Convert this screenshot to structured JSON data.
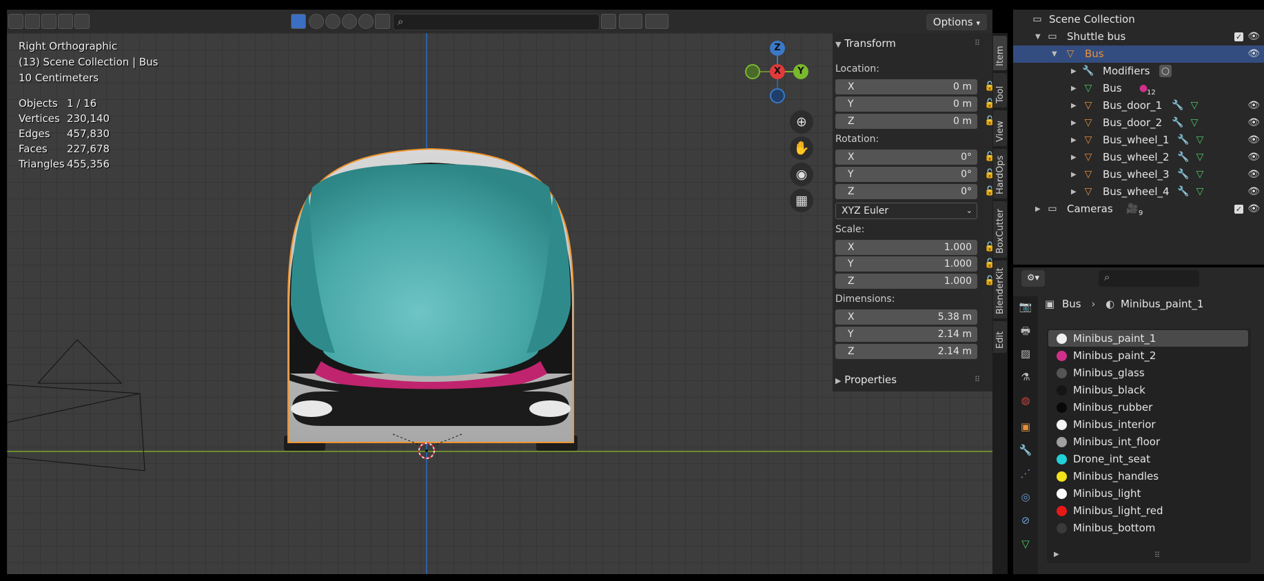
{
  "viewport": {
    "view_name": "Right Orthographic",
    "collection_info": "(13) Scene Collection | Bus",
    "grid_scale": "10 Centimeters",
    "stats": [
      {
        "label": "Objects",
        "value": "1 / 16"
      },
      {
        "label": "Vertices",
        "value": "230,140"
      },
      {
        "label": "Edges",
        "value": "457,830"
      },
      {
        "label": "Faces",
        "value": "227,678"
      },
      {
        "label": "Triangles",
        "value": "455,356"
      }
    ],
    "options_label": "Options",
    "gizmo": {
      "z": "Z",
      "x": "X",
      "y": "Y"
    }
  },
  "npanel": {
    "transform_title": "Transform",
    "location_label": "Location:",
    "location": [
      {
        "axis": "X",
        "value": "0 m"
      },
      {
        "axis": "Y",
        "value": "0 m"
      },
      {
        "axis": "Z",
        "value": "0 m"
      }
    ],
    "rotation_label": "Rotation:",
    "rotation": [
      {
        "axis": "X",
        "value": "0°"
      },
      {
        "axis": "Y",
        "value": "0°"
      },
      {
        "axis": "Z",
        "value": "0°"
      }
    ],
    "rotation_mode": "XYZ Euler",
    "scale_label": "Scale:",
    "scale": [
      {
        "axis": "X",
        "value": "1.000"
      },
      {
        "axis": "Y",
        "value": "1.000"
      },
      {
        "axis": "Z",
        "value": "1.000"
      }
    ],
    "dimensions_label": "Dimensions:",
    "dimensions": [
      {
        "axis": "X",
        "value": "5.38 m"
      },
      {
        "axis": "Y",
        "value": "2.14 m"
      },
      {
        "axis": "Z",
        "value": "2.14 m"
      }
    ],
    "properties_title": "Properties",
    "tabs": [
      "Item",
      "Tool",
      "View",
      "HardOps",
      "BoxCutter",
      "BlenderKit",
      "Edit"
    ]
  },
  "outliner": {
    "rows": [
      {
        "name": "Scene Collection",
        "icon": "collection-icon"
      },
      {
        "name": "Shuttle bus",
        "icon": "collection-icon"
      },
      {
        "name": "Bus",
        "icon": "mesh-object-icon"
      },
      {
        "name": "Modifiers",
        "icon": "wrench-icon"
      },
      {
        "name": "Bus",
        "icon": "mesh-data-icon",
        "badge": "12"
      },
      {
        "name": "Bus_door_1",
        "icon": "mesh-object-icon"
      },
      {
        "name": "Bus_door_2",
        "icon": "mesh-object-icon"
      },
      {
        "name": "Bus_wheel_1",
        "icon": "mesh-object-icon"
      },
      {
        "name": "Bus_wheel_2",
        "icon": "mesh-object-icon"
      },
      {
        "name": "Bus_wheel_3",
        "icon": "mesh-object-icon"
      },
      {
        "name": "Bus_wheel_4",
        "icon": "mesh-object-icon"
      },
      {
        "name": "Cameras",
        "icon": "collection-icon",
        "badge": "9"
      }
    ]
  },
  "properties": {
    "breadcrumb_object": "Bus",
    "breadcrumb_material": "Minibus_paint_1",
    "materials": [
      {
        "name": "Minibus_paint_1",
        "color": "#f0f0f0"
      },
      {
        "name": "Minibus_paint_2",
        "color": "#d0308a"
      },
      {
        "name": "Minibus_glass",
        "color": "#555555"
      },
      {
        "name": "Minibus_black",
        "color": "#151515"
      },
      {
        "name": "Minibus_rubber",
        "color": "#080808"
      },
      {
        "name": "Minibus_interior",
        "color": "#f4f4f4"
      },
      {
        "name": "Minibus_int_floor",
        "color": "#a0a0a0"
      },
      {
        "name": "Drone_int_seat",
        "color": "#22d0d8"
      },
      {
        "name": "Minibus_handles",
        "color": "#f2e21a"
      },
      {
        "name": "Minibus_light",
        "color": "#ffffff"
      },
      {
        "name": "Minibus_light_red",
        "color": "#e81818"
      },
      {
        "name": "Minibus_bottom",
        "color": "#3a3a3a"
      }
    ]
  }
}
